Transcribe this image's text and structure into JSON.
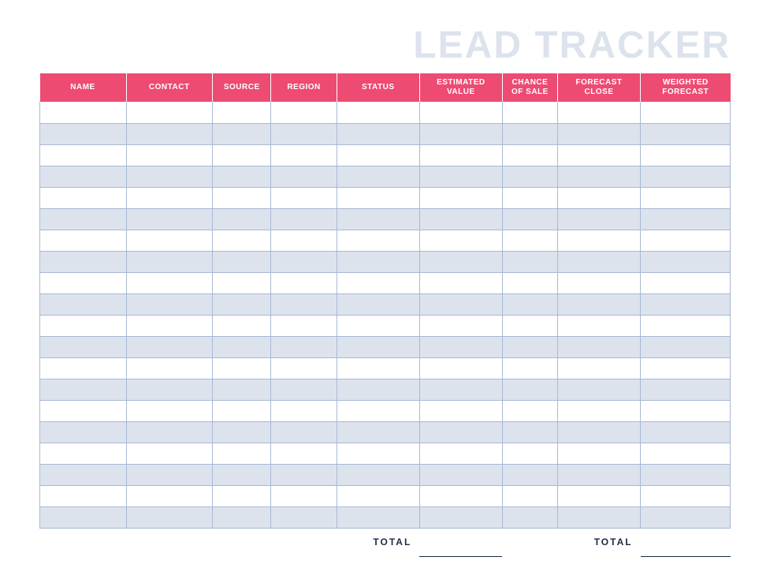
{
  "title": "LEAD TRACKER",
  "columns": {
    "name": "NAME",
    "contact": "CONTACT",
    "source": "SOURCE",
    "region": "REGION",
    "status": "STATUS",
    "estimated_value": "ESTIMATED\nVALUE",
    "chance_of_sale": "CHANCE\nOF SALE",
    "forecast_close": "FORECAST\nCLOSE",
    "weighted_forecast": "WEIGHTED\nFORECAST"
  },
  "rows": [
    {
      "name": "",
      "contact": "",
      "source": "",
      "region": "",
      "status": "",
      "estimated_value": "",
      "chance_of_sale": "",
      "forecast_close": "",
      "weighted_forecast": ""
    },
    {
      "name": "",
      "contact": "",
      "source": "",
      "region": "",
      "status": "",
      "estimated_value": "",
      "chance_of_sale": "",
      "forecast_close": "",
      "weighted_forecast": ""
    },
    {
      "name": "",
      "contact": "",
      "source": "",
      "region": "",
      "status": "",
      "estimated_value": "",
      "chance_of_sale": "",
      "forecast_close": "",
      "weighted_forecast": ""
    },
    {
      "name": "",
      "contact": "",
      "source": "",
      "region": "",
      "status": "",
      "estimated_value": "",
      "chance_of_sale": "",
      "forecast_close": "",
      "weighted_forecast": ""
    },
    {
      "name": "",
      "contact": "",
      "source": "",
      "region": "",
      "status": "",
      "estimated_value": "",
      "chance_of_sale": "",
      "forecast_close": "",
      "weighted_forecast": ""
    },
    {
      "name": "",
      "contact": "",
      "source": "",
      "region": "",
      "status": "",
      "estimated_value": "",
      "chance_of_sale": "",
      "forecast_close": "",
      "weighted_forecast": ""
    },
    {
      "name": "",
      "contact": "",
      "source": "",
      "region": "",
      "status": "",
      "estimated_value": "",
      "chance_of_sale": "",
      "forecast_close": "",
      "weighted_forecast": ""
    },
    {
      "name": "",
      "contact": "",
      "source": "",
      "region": "",
      "status": "",
      "estimated_value": "",
      "chance_of_sale": "",
      "forecast_close": "",
      "weighted_forecast": ""
    },
    {
      "name": "",
      "contact": "",
      "source": "",
      "region": "",
      "status": "",
      "estimated_value": "",
      "chance_of_sale": "",
      "forecast_close": "",
      "weighted_forecast": ""
    },
    {
      "name": "",
      "contact": "",
      "source": "",
      "region": "",
      "status": "",
      "estimated_value": "",
      "chance_of_sale": "",
      "forecast_close": "",
      "weighted_forecast": ""
    },
    {
      "name": "",
      "contact": "",
      "source": "",
      "region": "",
      "status": "",
      "estimated_value": "",
      "chance_of_sale": "",
      "forecast_close": "",
      "weighted_forecast": ""
    },
    {
      "name": "",
      "contact": "",
      "source": "",
      "region": "",
      "status": "",
      "estimated_value": "",
      "chance_of_sale": "",
      "forecast_close": "",
      "weighted_forecast": ""
    },
    {
      "name": "",
      "contact": "",
      "source": "",
      "region": "",
      "status": "",
      "estimated_value": "",
      "chance_of_sale": "",
      "forecast_close": "",
      "weighted_forecast": ""
    },
    {
      "name": "",
      "contact": "",
      "source": "",
      "region": "",
      "status": "",
      "estimated_value": "",
      "chance_of_sale": "",
      "forecast_close": "",
      "weighted_forecast": ""
    },
    {
      "name": "",
      "contact": "",
      "source": "",
      "region": "",
      "status": "",
      "estimated_value": "",
      "chance_of_sale": "",
      "forecast_close": "",
      "weighted_forecast": ""
    },
    {
      "name": "",
      "contact": "",
      "source": "",
      "region": "",
      "status": "",
      "estimated_value": "",
      "chance_of_sale": "",
      "forecast_close": "",
      "weighted_forecast": ""
    },
    {
      "name": "",
      "contact": "",
      "source": "",
      "region": "",
      "status": "",
      "estimated_value": "",
      "chance_of_sale": "",
      "forecast_close": "",
      "weighted_forecast": ""
    },
    {
      "name": "",
      "contact": "",
      "source": "",
      "region": "",
      "status": "",
      "estimated_value": "",
      "chance_of_sale": "",
      "forecast_close": "",
      "weighted_forecast": ""
    },
    {
      "name": "",
      "contact": "",
      "source": "",
      "region": "",
      "status": "",
      "estimated_value": "",
      "chance_of_sale": "",
      "forecast_close": "",
      "weighted_forecast": ""
    },
    {
      "name": "",
      "contact": "",
      "source": "",
      "region": "",
      "status": "",
      "estimated_value": "",
      "chance_of_sale": "",
      "forecast_close": "",
      "weighted_forecast": ""
    }
  ],
  "totals": {
    "label1": "TOTAL",
    "value1": "",
    "label2": "TOTAL",
    "value2": ""
  }
}
